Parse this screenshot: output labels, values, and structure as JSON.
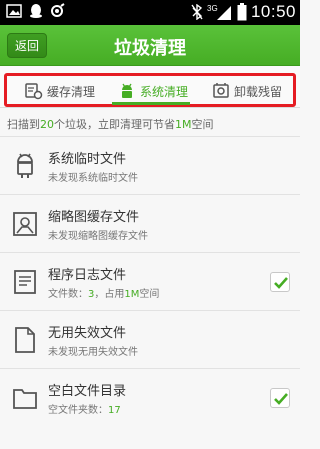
{
  "status_bar": {
    "icons": [
      "image-icon",
      "qq-icon",
      "voice-icon"
    ],
    "right_icons": [
      "bluetooth-off-icon",
      "3g-icon",
      "signal-icon",
      "battery-icon"
    ],
    "network": "3G",
    "time": "10:50"
  },
  "titlebar": {
    "back_label": "返回",
    "title": "垃圾清理"
  },
  "tabs": [
    {
      "label": "缓存清理",
      "icon": "cache-clean-icon",
      "active": false
    },
    {
      "label": "系统清理",
      "icon": "android-icon",
      "active": true
    },
    {
      "label": "卸载残留",
      "icon": "uninstall-remains-icon",
      "active": false
    }
  ],
  "summary": {
    "prefix": "扫描到",
    "count": "20",
    "middle": "个垃圾，立即清理可节省",
    "size": "1M",
    "suffix": "空间"
  },
  "items": [
    {
      "title": "系统临时文件",
      "sub_text": "未发现系统临时文件",
      "icon": "android-robot-icon",
      "checked": false
    },
    {
      "title": "缩略图缓存文件",
      "sub_text": "未发现缩略图缓存文件",
      "icon": "image-thumbnail-icon",
      "checked": false
    },
    {
      "title": "程序日志文件",
      "sub_prefix": "文件数：",
      "sub_count": "3",
      "sub_mid": "，占用",
      "sub_size": "1M",
      "sub_suffix": "空间",
      "icon": "document-log-icon",
      "checked": true
    },
    {
      "title": "无用失效文件",
      "sub_text": "未发现无用失效文件",
      "icon": "blank-file-icon",
      "checked": false
    },
    {
      "title": "空白文件目录",
      "sub_prefix": "空文件夹数：",
      "sub_count": "17",
      "icon": "folder-icon",
      "checked": true
    }
  ],
  "colors": {
    "accent": "#46ad24",
    "highlight_frame": "#e51c23"
  }
}
